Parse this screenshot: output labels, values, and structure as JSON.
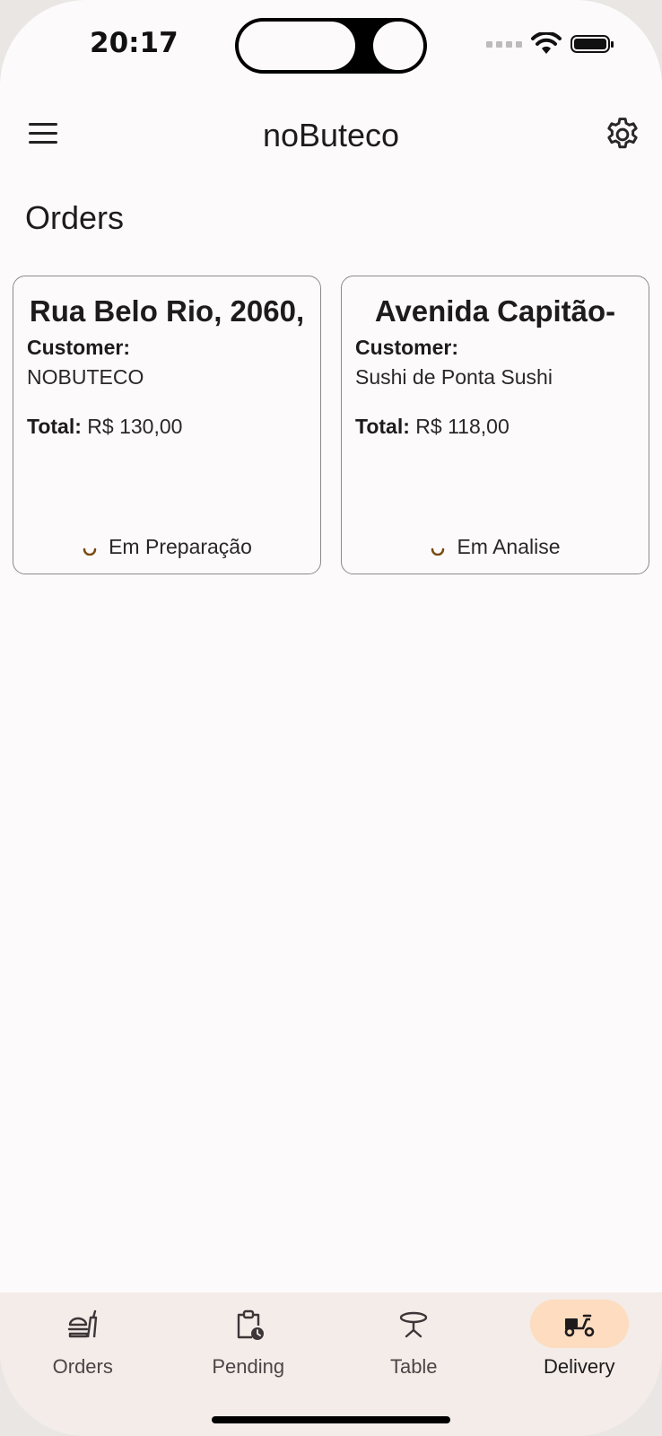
{
  "status_bar": {
    "time": "20:17"
  },
  "appbar": {
    "title": "noButeco"
  },
  "page": {
    "title": "Orders"
  },
  "orders": [
    {
      "address": "Rua Belo Rio, 2060,",
      "customer_label": "Customer:",
      "customer": "NOBUTECO",
      "total_label": "Total:",
      "total": "R$ 130,00",
      "status": "Em Preparação"
    },
    {
      "address": "Avenida Capitão-",
      "customer_label": "Customer:",
      "customer": "Sushi de Ponta Sushi",
      "total_label": "Total:",
      "total": "R$ 118,00",
      "status": "Em Analise"
    }
  ],
  "bottom_nav": [
    {
      "label": "Orders",
      "icon": "food-icon",
      "active": false
    },
    {
      "label": "Pending",
      "icon": "clipboard-clock-icon",
      "active": false
    },
    {
      "label": "Table",
      "icon": "table-icon",
      "active": false
    },
    {
      "label": "Delivery",
      "icon": "moped-icon",
      "active": true
    }
  ],
  "colors": {
    "background": "#fdfafc",
    "nav_background": "#f3ece8",
    "active_pill": "#fddcc0",
    "spinner": "#7a4a12"
  }
}
